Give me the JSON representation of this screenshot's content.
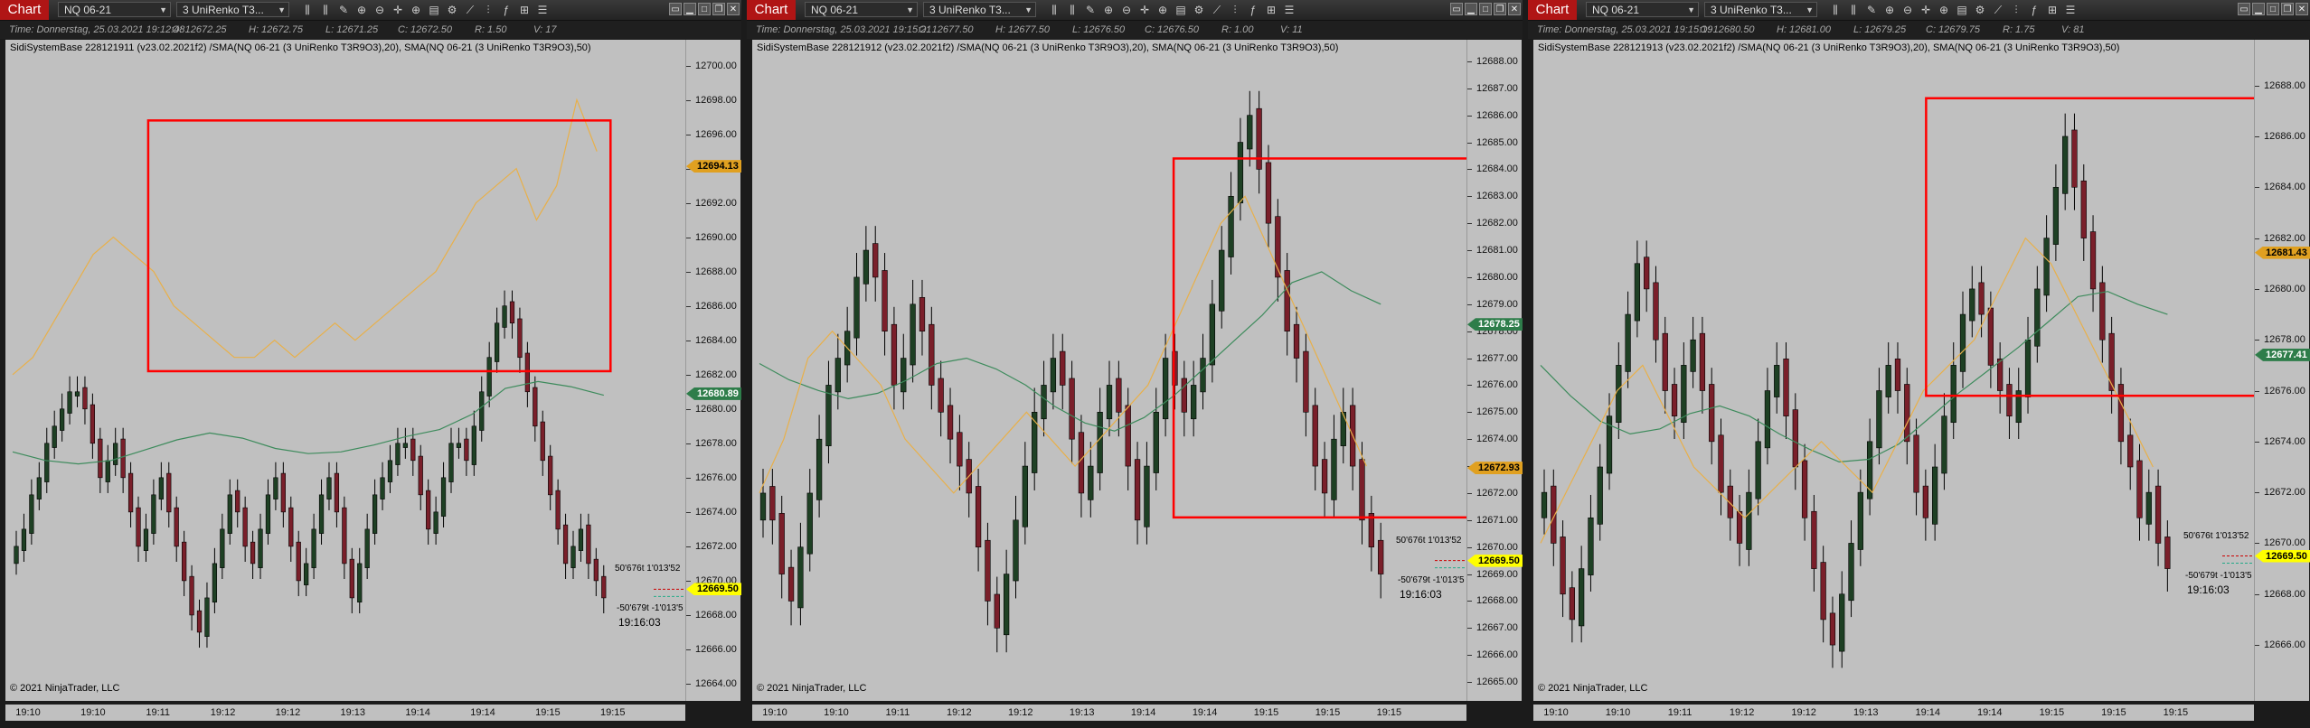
{
  "colors": {
    "plot_bg": "#c0c0c0",
    "bar_up": "#1e4024",
    "bar_down": "#7a1f2a",
    "sma20": "#e8b04a",
    "sma50": "#3d8b5c",
    "highlight_box": "#ff0000",
    "last_price": "#ffff00"
  },
  "panels": [
    {
      "tab_label": "Chart",
      "instrument": "NQ 06-21",
      "period": "3 UniRenko T3...",
      "info": {
        "time": "Time: Donnerstag, 25.03.2021 19:12:48",
        "open": "O: 12672.25",
        "high": "H: 12672.75",
        "low": "L: 12671.25",
        "close": "C: 12672.50",
        "range": "R: 1.50",
        "volume": "V: 17"
      },
      "study_label": "SidiSystemBase 228121911 (v23.02.2021f2) /SMA(NQ 06-21 (3 UniRenko T3R9O3),20), SMA(NQ 06-21 (3 UniRenko T3R9O3),50)",
      "copyright": "© 2021 NinjaTrader, LLC",
      "y_ticks": [
        "12700.00",
        "12698.00",
        "12696.00",
        "12694.00",
        "12692.00",
        "12690.00",
        "12688.00",
        "12686.00",
        "12684.00",
        "12682.00",
        "12680.00",
        "12678.00",
        "12676.00",
        "12674.00",
        "12672.00",
        "12670.00",
        "12668.00",
        "12666.00",
        "12664.00"
      ],
      "x_ticks": [
        "19:10",
        "19:10",
        "19:11",
        "19:12",
        "19:12",
        "19:13",
        "19:14",
        "19:14",
        "19:15",
        "19:15"
      ],
      "badges": [
        {
          "value": "12694.13",
          "price": 12694.13,
          "color": "#e0a020",
          "text": "#000"
        },
        {
          "value": "12680.89",
          "price": 12680.89,
          "color": "#2e7d4a",
          "text": "#fff"
        },
        {
          "value": "12669.50",
          "price": 12669.5,
          "color": "#ffff00",
          "text": "#000"
        }
      ],
      "annotations": {
        "target": "50'676t 1'013'52",
        "stop": "-50'679t -1'013'5",
        "time": "19:16:03"
      },
      "chart_data": {
        "type": "candlestick",
        "ylim": [
          12663.0,
          12701.5
        ],
        "close": [
          12672,
          12673,
          12675,
          12676,
          12678,
          12679,
          12680,
          12681,
          12681,
          12680,
          12678,
          12676,
          12677,
          12678,
          12676,
          12674,
          12672,
          12673,
          12675,
          12676,
          12674,
          12672,
          12670,
          12668,
          12667,
          12669,
          12671,
          12673,
          12675,
          12674,
          12672,
          12671,
          12673,
          12675,
          12676,
          12674,
          12672,
          12670,
          12671,
          12673,
          12675,
          12676,
          12674,
          12671,
          12669,
          12671,
          12673,
          12675,
          12676,
          12677,
          12678,
          12678,
          12677,
          12675,
          12673,
          12674,
          12676,
          12678,
          12678,
          12677,
          12679,
          12681,
          12683,
          12685,
          12686,
          12685,
          12683,
          12681,
          12679,
          12677,
          12675,
          12673,
          12671,
          12672,
          12673,
          12671,
          12670,
          12669
        ],
        "sma20": [
          12682,
          12683,
          12685,
          12687,
          12689,
          12690,
          12689,
          12688,
          12686,
          12685,
          12684,
          12683,
          12683,
          12684,
          12683,
          12684,
          12685,
          12684,
          12685,
          12686,
          12687,
          12688,
          12690,
          12692,
          12693,
          12694,
          12691,
          12693,
          12698,
          12695
        ],
        "sma50": [
          12677.5,
          12677,
          12676.8,
          12677,
          12677.6,
          12678.2,
          12678.6,
          12678.3,
          12677.7,
          12677.4,
          12677.5,
          12677.9,
          12678.4,
          12678.8,
          12679.7,
          12681.2,
          12681.6,
          12681.3,
          12680.8
        ],
        "box": {
          "x0": 0.21,
          "x1": 0.89,
          "y_top": 12696.8,
          "y_bottom": 12682.2
        }
      }
    },
    {
      "tab_label": "Chart",
      "instrument": "NQ 06-21",
      "period": "3 UniRenko T3...",
      "info": {
        "time": "Time: Donnerstag, 25.03.2021 19:15:21",
        "open": "O: 12677.50",
        "high": "H: 12677.50",
        "low": "L: 12676.50",
        "close": "C: 12676.50",
        "range": "R: 1.00",
        "volume": "V: 11"
      },
      "study_label": "SidiSystemBase 228121912 (v23.02.2021f2) /SMA(NQ 06-21 (3 UniRenko T3R9O3),20), SMA(NQ 06-21 (3 UniRenko T3R9O3),50)",
      "copyright": "© 2021 NinjaTrader, LLC",
      "y_ticks": [
        "12688.00",
        "12687.00",
        "12686.00",
        "12685.00",
        "12684.00",
        "12683.00",
        "12682.00",
        "12681.00",
        "12680.00",
        "12679.00",
        "12678.00",
        "12677.00",
        "12676.00",
        "12675.00",
        "12674.00",
        "12673.00",
        "12672.00",
        "12671.00",
        "12670.00",
        "12669.00",
        "12668.00",
        "12667.00",
        "12666.00",
        "12665.00"
      ],
      "x_ticks": [
        "19:10",
        "19:10",
        "19:11",
        "19:12",
        "19:12",
        "19:13",
        "19:14",
        "19:14",
        "19:15",
        "19:15",
        "19:15"
      ],
      "badges": [
        {
          "value": "12678.25",
          "price": 12678.25,
          "color": "#2e7d4a",
          "text": "#fff"
        },
        {
          "value": "12672.93",
          "price": 12672.93,
          "color": "#e0a020",
          "text": "#000"
        },
        {
          "value": "12669.50",
          "price": 12669.5,
          "color": "#ffff00",
          "text": "#000"
        }
      ],
      "annotations": {
        "target": "50'676t 1'013'52",
        "stop": "-50'679t -1'013'5",
        "time": "19:16:03"
      },
      "chart_data": {
        "type": "candlestick",
        "ylim": [
          12664.3,
          12688.8
        ],
        "close": [
          12672,
          12671,
          12669,
          12668,
          12670,
          12672,
          12674,
          12676,
          12677,
          12678,
          12680,
          12681,
          12680,
          12678,
          12676,
          12677,
          12679,
          12678,
          12676,
          12675,
          12674,
          12673,
          12672,
          12670,
          12668,
          12667,
          12669,
          12671,
          12673,
          12675,
          12676,
          12677,
          12676,
          12674,
          12672,
          12673,
          12675,
          12676,
          12675,
          12673,
          12671,
          12673,
          12675,
          12677,
          12676,
          12675,
          12676,
          12677,
          12679,
          12681,
          12683,
          12685,
          12686,
          12684,
          12682,
          12680,
          12678,
          12677,
          12675,
          12673,
          12672,
          12674,
          12675,
          12673,
          12671,
          12670,
          12669
        ],
        "sma20": [
          12672,
          12674,
          12677,
          12678,
          12677,
          12676,
          12674,
          12673,
          12672,
          12673,
          12674,
          12675,
          12674,
          12673,
          12674,
          12675,
          12676,
          12678,
          12680,
          12682,
          12683,
          12681,
          12679,
          12677,
          12675,
          12673
        ],
        "sma50": [
          12676.8,
          12676.2,
          12675.8,
          12675.5,
          12675.7,
          12676.2,
          12676.8,
          12677,
          12676.6,
          12676,
          12675.2,
          12674.6,
          12674.3,
          12674.8,
          12675.6,
          12676.6,
          12677.6,
          12678.6,
          12679.8,
          12680.2,
          12679.5,
          12679
        ],
        "box": {
          "x0": 0.59,
          "x1": 1.07,
          "y_top": 12684.4,
          "y_bottom": 12671.1
        }
      }
    },
    {
      "tab_label": "Chart",
      "instrument": "NQ 06-21",
      "period": "3 UniRenko T3...",
      "info": {
        "time": "Time: Donnerstag, 25.03.2021 19:15:19",
        "open": "O: 12680.50",
        "high": "H: 12681.00",
        "low": "L: 12679.25",
        "close": "C: 12679.75",
        "range": "R: 1.75",
        "volume": "V: 81"
      },
      "study_label": "SidiSystemBase 228121913 (v23.02.2021f2) /SMA(NQ 06-21 (3 UniRenko T3R9O3),20), SMA(NQ 06-21 (3 UniRenko T3R9O3),50)",
      "copyright": "© 2021 NinjaTrader, LLC",
      "y_ticks": [
        "12688.00",
        "12686.00",
        "12684.00",
        "12682.00",
        "12680.00",
        "12678.00",
        "12676.00",
        "12674.00",
        "12672.00",
        "12670.00",
        "12668.00",
        "12666.00"
      ],
      "x_ticks": [
        "19:10",
        "19:10",
        "19:11",
        "19:12",
        "19:12",
        "19:13",
        "19:14",
        "19:14",
        "19:15",
        "19:15",
        "19:15"
      ],
      "badges": [
        {
          "value": "12681.43",
          "price": 12681.43,
          "color": "#e0a020",
          "text": "#000"
        },
        {
          "value": "12677.41",
          "price": 12677.41,
          "color": "#2e7d4a",
          "text": "#fff"
        },
        {
          "value": "12669.50",
          "price": 12669.5,
          "color": "#ffff00",
          "text": "#000"
        }
      ],
      "annotations": {
        "target": "50'676t 1'013'52",
        "stop": "-50'679t -1'013'5",
        "time": "19:16:03"
      },
      "chart_data": {
        "type": "candlestick",
        "ylim": [
          12663.8,
          12689.8
        ],
        "close": [
          12672,
          12670,
          12668,
          12667,
          12669,
          12671,
          12673,
          12675,
          12677,
          12679,
          12681,
          12680,
          12678,
          12676,
          12675,
          12677,
          12678,
          12676,
          12674,
          12672,
          12671,
          12670,
          12672,
          12674,
          12676,
          12677,
          12675,
          12673,
          12671,
          12669,
          12667,
          12666,
          12668,
          12670,
          12672,
          12674,
          12676,
          12677,
          12676,
          12674,
          12672,
          12671,
          12673,
          12675,
          12677,
          12679,
          12680,
          12679,
          12677,
          12676,
          12675,
          12676,
          12678,
          12680,
          12682,
          12684,
          12686,
          12684,
          12682,
          12680,
          12678,
          12676,
          12674,
          12673,
          12671,
          12672,
          12670,
          12669
        ],
        "sma20": [
          12670,
          12672,
          12674,
          12676,
          12677,
          12675,
          12673,
          12672,
          12671,
          12672,
          12673,
          12674,
          12673,
          12672,
          12674,
          12676,
          12677,
          12678,
          12680,
          12682,
          12681,
          12679,
          12677,
          12675,
          12673
        ],
        "sma50": [
          12677,
          12675.8,
          12674.8,
          12674.3,
          12674.5,
          12675.1,
          12675.4,
          12675,
          12674.3,
          12673.7,
          12673.2,
          12673.3,
          12673.9,
          12674.9,
          12675.9,
          12676.8,
          12677.7,
          12678.7,
          12679.7,
          12679.9,
          12679.4,
          12679
        ],
        "box": {
          "x0": 0.545,
          "x1": 1.03,
          "y_top": 12687.5,
          "y_bottom": 12675.8
        }
      }
    }
  ]
}
